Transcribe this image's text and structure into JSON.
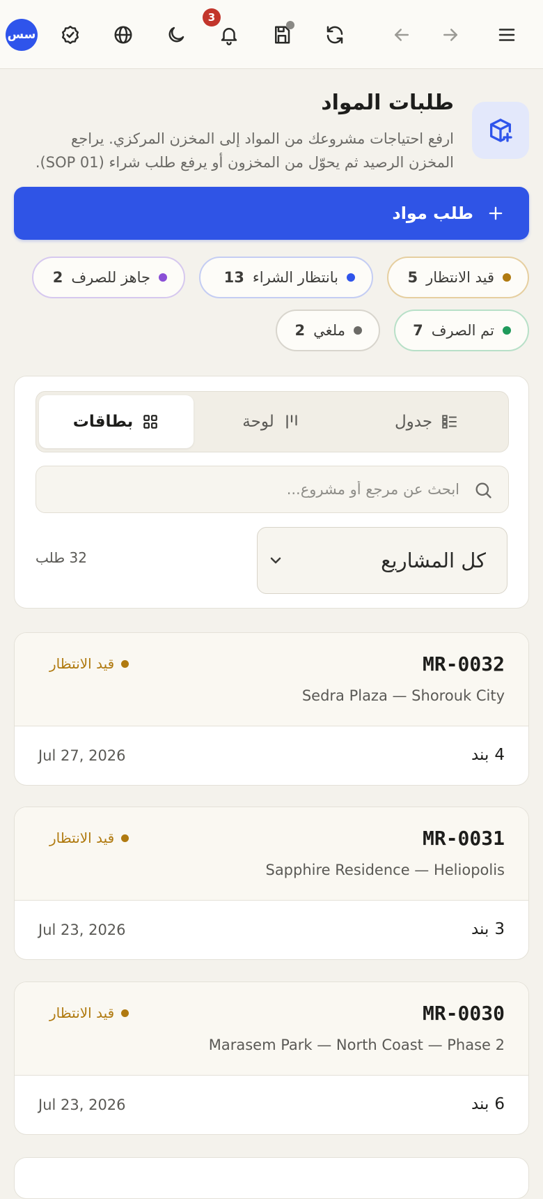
{
  "topbar": {
    "avatar_initials": "سس",
    "notifications_count": "3",
    "icons": [
      "menu-icon",
      "forward-arrow-icon",
      "back-arrow-icon",
      "refresh-icon",
      "save-icon",
      "bell-icon",
      "moon-icon",
      "globe-icon",
      "check-badge-icon"
    ]
  },
  "header": {
    "title": "طلبات المواد",
    "description": "ارفع احتياجات مشروعك من المواد إلى المخزن المركزي. يراجع المخزن الرصيد ثم يحوّل من المخزون أو يرفع طلب شراء (SOP 01).",
    "icon": "package-plus-icon"
  },
  "primary_action": {
    "label": "طلب مواد"
  },
  "status_chips": [
    {
      "label": "قيد الانتظار",
      "count": "5",
      "color": "#b07a10",
      "border": "#e6cfa0"
    },
    {
      "label": "بانتظار الشراء",
      "count": "13",
      "color": "#2f54eb",
      "border": "#c4cdf3"
    },
    {
      "label": "جاهز للصرف",
      "count": "2",
      "color": "#8a4fd6",
      "border": "#d6c8ef"
    },
    {
      "label": "تم الصرف",
      "count": "7",
      "color": "#1f9a5b",
      "border": "#b8e0c8"
    },
    {
      "label": "ملغي",
      "count": "2",
      "color": "#6b6a66",
      "border": "#d8d5cd"
    }
  ],
  "views": {
    "table": "جدول",
    "board": "لوحة",
    "cards": "بطاقات",
    "active": "cards"
  },
  "search": {
    "placeholder": "ابحث عن مرجع أو مشروع..."
  },
  "project_filter": {
    "selected": "كل المشاريع"
  },
  "results_count": "32 طلب",
  "requests": [
    {
      "ref": "MR-0032",
      "project": "Sedra Plaza — Shorouk City",
      "status": "قيد الانتظار",
      "items_label": "بند",
      "items_count": "4",
      "date": "Jul 27, 2026"
    },
    {
      "ref": "MR-0031",
      "project": "Sapphire Residence — Heliopolis",
      "status": "قيد الانتظار",
      "items_label": "بند",
      "items_count": "3",
      "date": "Jul 23, 2026"
    },
    {
      "ref": "MR-0030",
      "project": "Marasem Park — North Coast — Phase 2",
      "status": "قيد الانتظار",
      "items_label": "بند",
      "items_count": "6",
      "date": "Jul 23, 2026"
    }
  ]
}
